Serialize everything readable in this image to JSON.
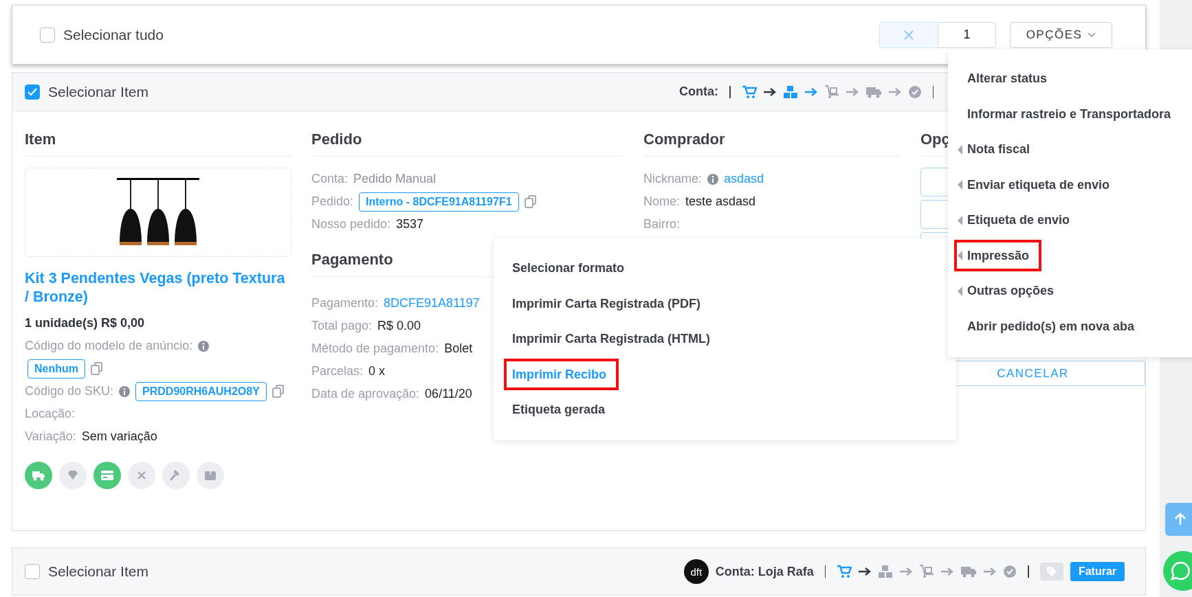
{
  "toolbar": {
    "select_all": {
      "label": "Selecionar tudo",
      "checked": false
    },
    "page_field": {
      "value": "1"
    },
    "options_button": "OPÇÕES"
  },
  "orders": [
    {
      "selected": true,
      "select_label": "Selecionar Item",
      "account_label": "Conta:",
      "steps": [
        {
          "kind": "cart",
          "color": "#1a9bfc"
        },
        {
          "kind": "arrow",
          "color": "#333a45"
        },
        {
          "kind": "boxes",
          "color": "#1a9bfc"
        },
        {
          "kind": "arrow",
          "color": "#1a9bfc"
        },
        {
          "kind": "dolly",
          "color": "#a3a8b4"
        },
        {
          "kind": "arrow",
          "color": "#a3a8b4"
        },
        {
          "kind": "truck",
          "color": "#a3a8b4"
        },
        {
          "kind": "arrow",
          "color": "#a3a8b4"
        },
        {
          "kind": "check",
          "color": "#a3a8b4"
        }
      ],
      "item": {
        "heading": "Item",
        "title": "Kit 3 Pendentes Vegas (preto Textura / Bronze)",
        "quantity_price": "1 unidade(s) R$ 0,00",
        "ad_model_label": "Código do modelo de anúncio:",
        "ad_model_code": "Nenhum",
        "sku_label": "Código do SKU:",
        "sku_code": "PRDD90RH6AUH2O8Y",
        "location_label": "Locação:",
        "variation_label": "Variação:",
        "variation": "Sem variação",
        "actions": [
          {
            "kind": "truck",
            "active": true
          },
          {
            "kind": "diamond",
            "active": false
          },
          {
            "kind": "card",
            "active": true
          },
          {
            "kind": "cancel",
            "active": false
          },
          {
            "kind": "hammer",
            "active": false
          },
          {
            "kind": "box",
            "active": false
          }
        ]
      },
      "order": {
        "heading": "Pedido",
        "rows": [
          {
            "label": "Conta:",
            "value": "Pedido Manual",
            "kind": "muted"
          },
          {
            "label": "Pedido:",
            "value": "Interno - 8DCFE91A81197F1",
            "kind": "tag"
          },
          {
            "label": "Nosso pedido:",
            "value": "3537",
            "kind": "plain"
          }
        ]
      },
      "payment": {
        "heading": "Pagamento",
        "rows": [
          {
            "label": "Pagamento:",
            "value": "8DCFE91A81197",
            "kind": "link"
          },
          {
            "label": "Total pago:",
            "value": "R$ 0.00",
            "kind": "plain"
          },
          {
            "label": "Método de pagamento:",
            "value": "Bolet",
            "kind": "plain"
          },
          {
            "label": "Parcelas:",
            "value": "0 x",
            "kind": "plain"
          },
          {
            "label": "Data de aprovação:",
            "value": "06/11/20",
            "kind": "plain"
          }
        ]
      },
      "buyer": {
        "heading": "Comprador",
        "rows": [
          {
            "label": "Nickname:",
            "value": "asdasd",
            "kind": "info-link"
          },
          {
            "label": "Nome:",
            "value": "teste asdasd",
            "kind": "plain"
          },
          {
            "label": "Bairro:",
            "kind": "plain"
          }
        ]
      },
      "options": {
        "heading": "Opç",
        "cancel_button": "CANCELAR"
      }
    },
    {
      "selected": false,
      "select_label": "Selecionar Item",
      "account_logo": "dft",
      "account_label": "Conta: Loja Rafa",
      "steps": [
        {
          "kind": "cart",
          "color": "#1a9bfc"
        },
        {
          "kind": "arrow",
          "color": "#333a45"
        },
        {
          "kind": "boxes",
          "color": "#a3a8b4"
        },
        {
          "kind": "arrow",
          "color": "#a3a8b4"
        },
        {
          "kind": "dolly",
          "color": "#a3a8b4"
        },
        {
          "kind": "arrow",
          "color": "#a3a8b4"
        },
        {
          "kind": "truck",
          "color": "#a3a8b4"
        },
        {
          "kind": "arrow",
          "color": "#a3a8b4"
        },
        {
          "kind": "check",
          "color": "#a3a8b4"
        }
      ],
      "invoice_button": "Faturar"
    }
  ],
  "options_menu": {
    "items": [
      {
        "label": "Alterar status",
        "submenu": false,
        "marked": false
      },
      {
        "label": "Informar rastreio e Transportadora",
        "submenu": false,
        "marked": false
      },
      {
        "label": "Nota fiscal",
        "submenu": true,
        "marked": false
      },
      {
        "label": "Enviar etiqueta de envio",
        "submenu": true,
        "marked": false
      },
      {
        "label": "Etiqueta de envio",
        "submenu": true,
        "marked": false
      },
      {
        "label": "Impressão",
        "submenu": true,
        "marked": true
      },
      {
        "label": "Outras opções",
        "submenu": true,
        "marked": false
      },
      {
        "label": "Abrir pedido(s) em nova aba",
        "submenu": false,
        "marked": false
      }
    ]
  },
  "print_submenu": {
    "items": [
      {
        "label": "Selecionar formato",
        "highlighted": false,
        "marked": false
      },
      {
        "label": "Imprimir Carta Registrada (PDF)",
        "highlighted": false,
        "marked": false
      },
      {
        "label": "Imprimir Carta Registrada (HTML)",
        "highlighted": false,
        "marked": false
      },
      {
        "label": "Imprimir Recibo",
        "highlighted": true,
        "marked": true
      },
      {
        "label": "Etiqueta gerada",
        "highlighted": false,
        "marked": false
      }
    ]
  }
}
